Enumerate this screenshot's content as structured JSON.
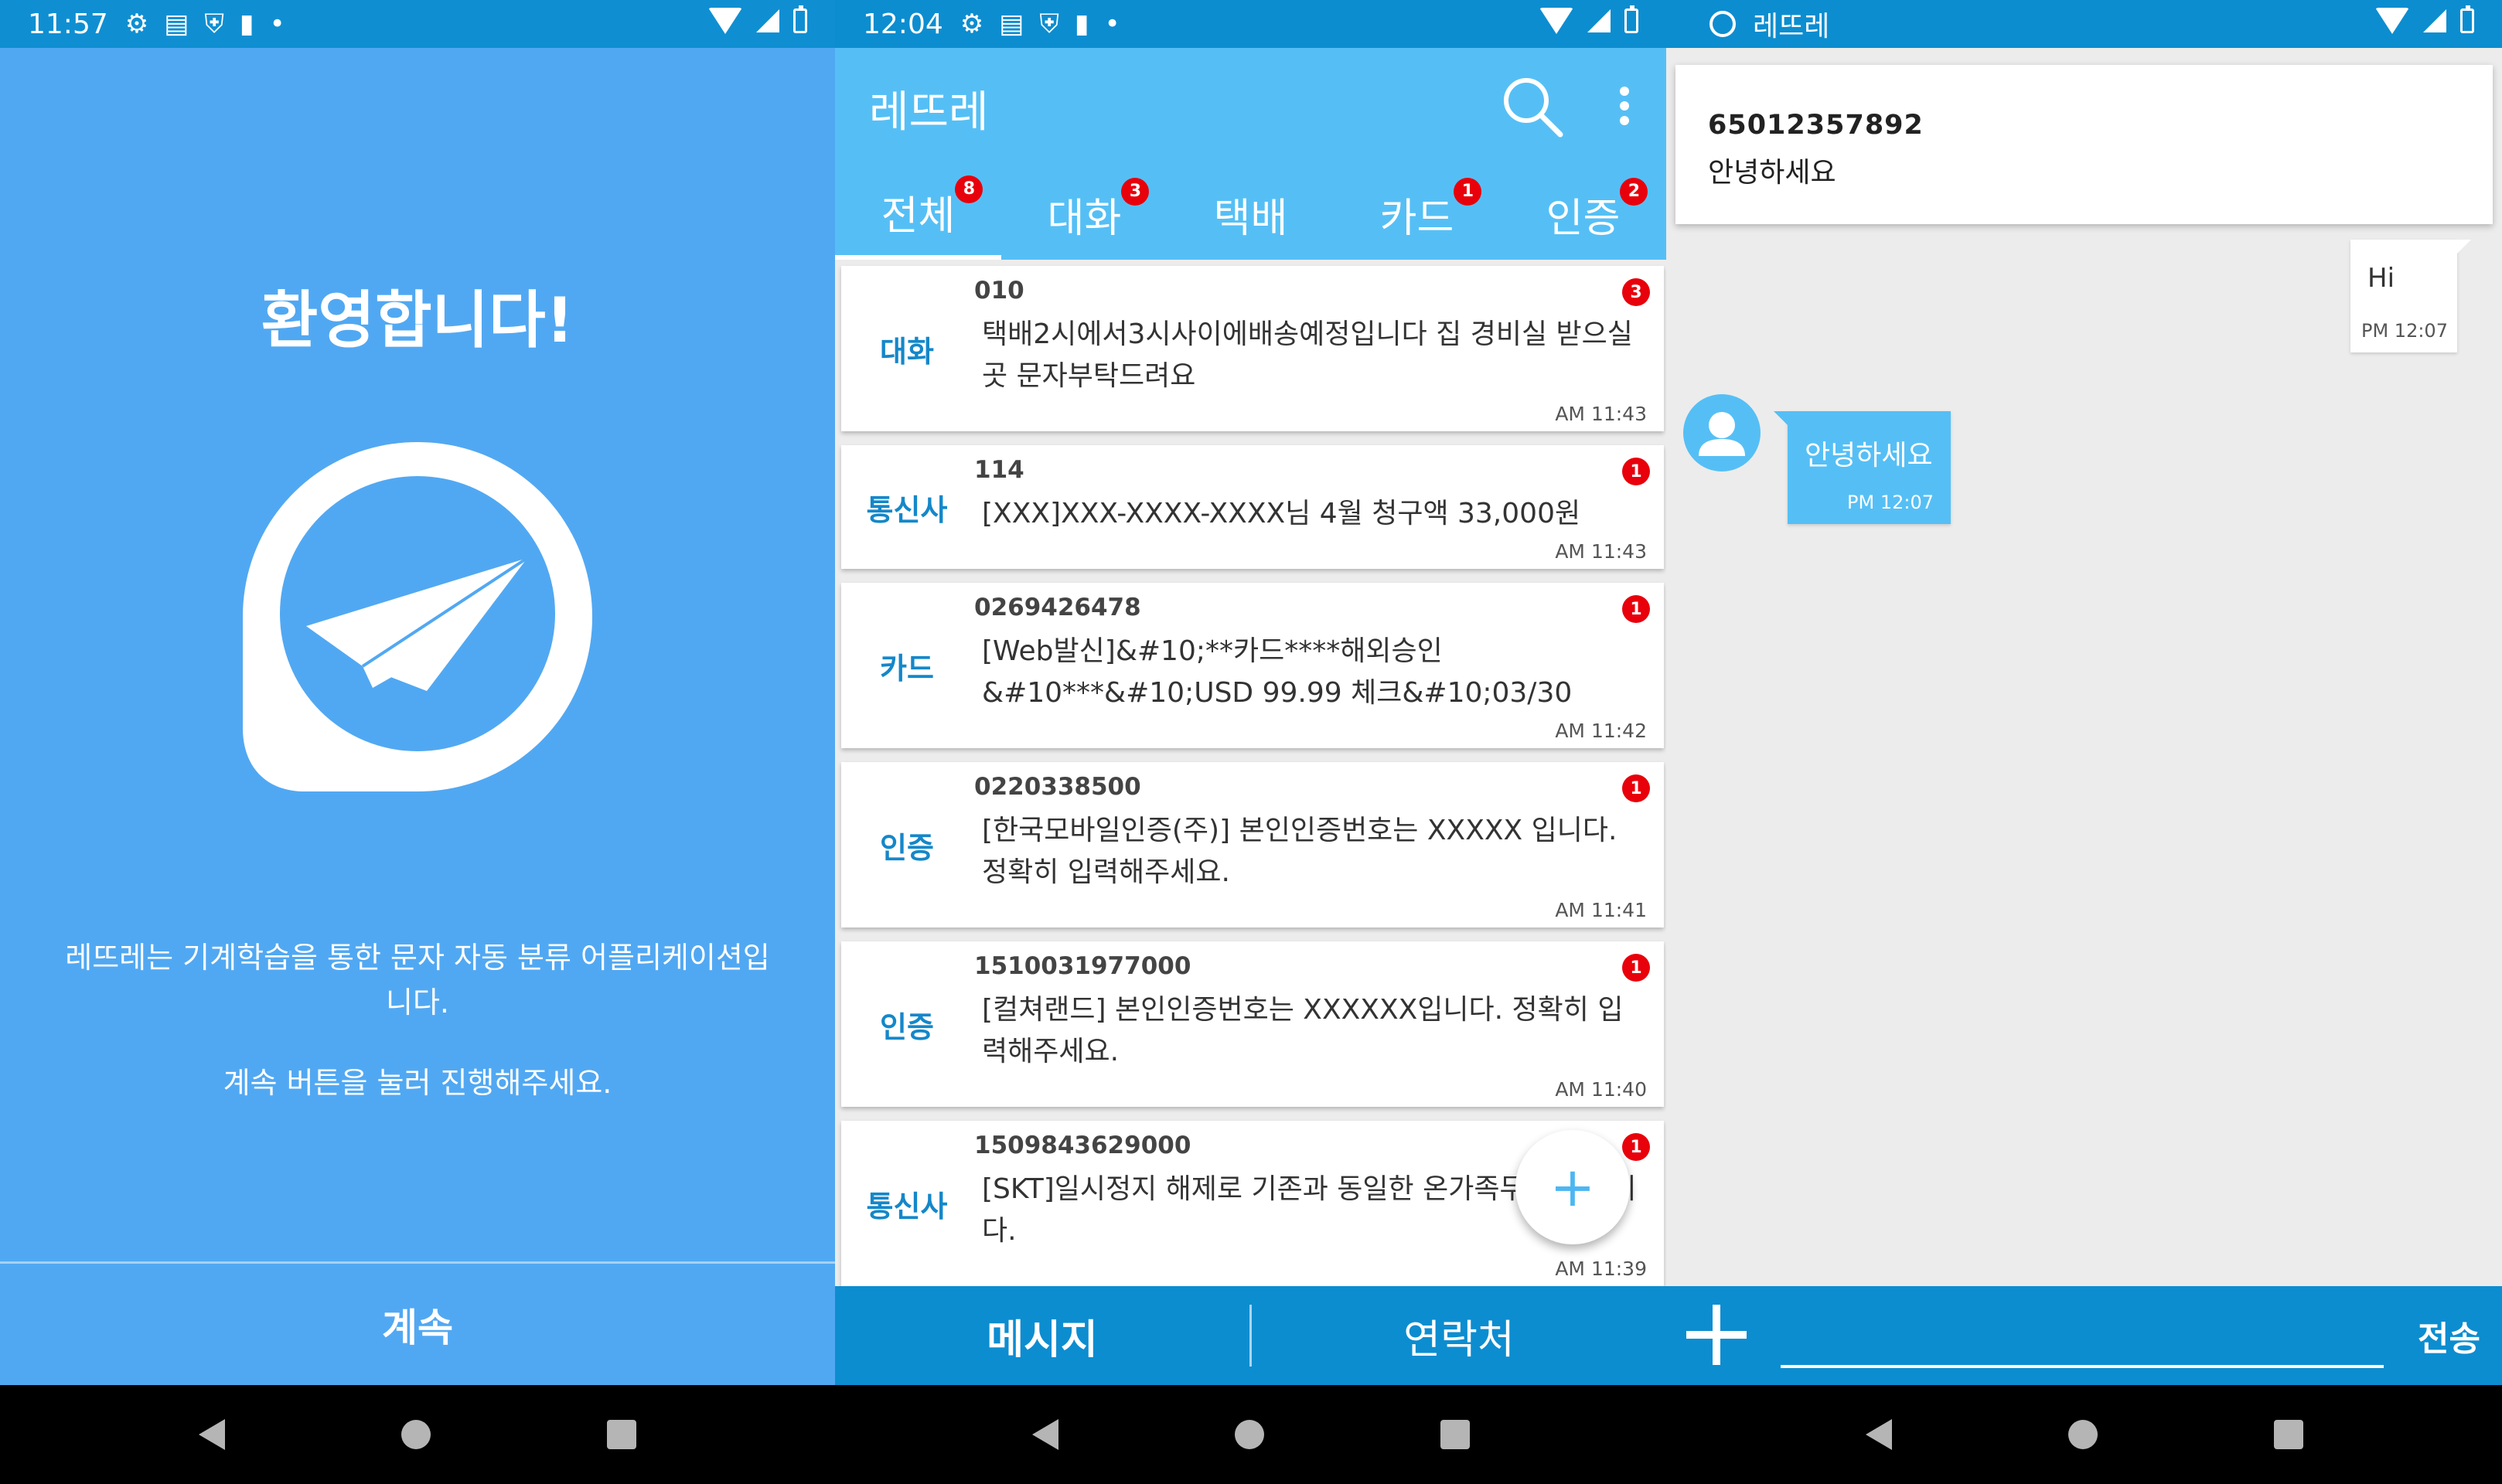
{
  "screen1": {
    "time": "11:57",
    "welcome": "환영합니다!",
    "description": "레뜨레는 기계학습을 통한 문자 자동 분류 어플리케이션입니다.",
    "instruction": "계속 버튼을 눌러 진행해주세요.",
    "continue_label": "계속"
  },
  "screen2": {
    "time": "12:04",
    "app_title": "레뜨레",
    "tabs": [
      {
        "label": "전체",
        "badge": "8"
      },
      {
        "label": "대화",
        "badge": "3"
      },
      {
        "label": "택배",
        "badge": ""
      },
      {
        "label": "카드",
        "badge": "1"
      },
      {
        "label": "인증",
        "badge": "2"
      }
    ],
    "messages": [
      {
        "category": "대화",
        "sender": "010",
        "text": "택배2시에서3시사이에배송예정입니다 집 경비실 받으실 곳 문자부탁드려요",
        "time": "AM 11:43",
        "badge": "3"
      },
      {
        "category": "통신사",
        "sender": "114",
        "text": "[XXX]XXX-XXXX-XXXX님 4월 청구액 33,000원",
        "time": "AM 11:43",
        "badge": "1"
      },
      {
        "category": "카드",
        "sender": "0269426478",
        "text": "[Web발신]&#10;**카드****해외승인 &#10***&#10;USD 99.99 체크&#10;03/30",
        "time": "AM 11:42",
        "badge": "1"
      },
      {
        "category": "인증",
        "sender": "0220338500",
        "text": "[한국모바일인증(주)] 본인인증번호는 XXXXX 입니다. 정확히 입력해주세요.",
        "time": "AM 11:41",
        "badge": "1"
      },
      {
        "category": "인증",
        "sender": "1510031977000",
        "text": "[컬쳐랜드] 본인인증번호는 XXXXXX입니다. 정확히 입력해주세요.",
        "time": "AM 11:40",
        "badge": "1"
      },
      {
        "category": "통신사",
        "sender": "1509843629000",
        "text": "[SKT]일시정지 해제로 기존과 동일한 온가족무 적용됩니다.",
        "time": "AM 11:39",
        "badge": "1"
      }
    ],
    "fab_label": "+",
    "bottom_tabs": [
      "메시지",
      "연락처"
    ]
  },
  "screen3": {
    "app_title": "레뜨레",
    "notification": {
      "title": "65012357892",
      "text": "안녕하세요"
    },
    "outgoing": {
      "text": "Hi",
      "time": "PM 12:07"
    },
    "incoming": {
      "text": "안녕하세요",
      "time": "PM 12:07"
    },
    "input_placeholder": "",
    "send_label": "전송"
  },
  "colors": {
    "primary": "#55bff5",
    "primary_dark": "#0c8dd0",
    "welcome_bg": "#51a8f2",
    "badge": "#e8000b",
    "category_text": "#1587c9"
  }
}
